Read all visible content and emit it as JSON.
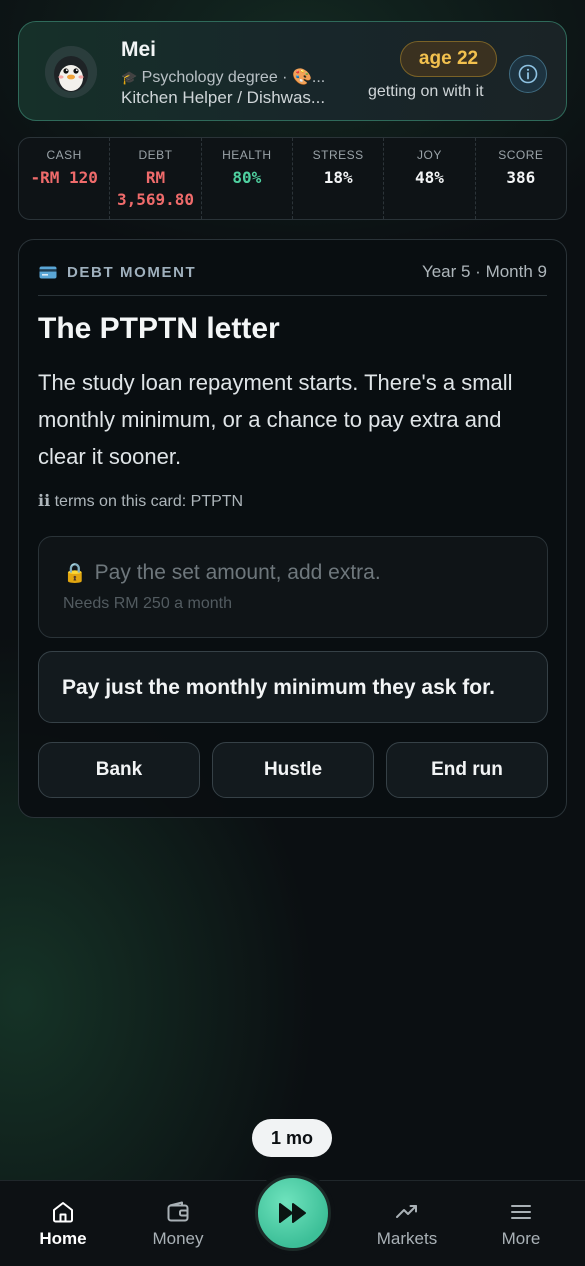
{
  "profile": {
    "name": "Mei",
    "avatar_icon": "penguin-icon",
    "degree_line": "Psychology degree · 🎨...",
    "job_line": "Kitchen Helper / Dishwas...",
    "age_label": "age 22",
    "age_status": "getting on with it"
  },
  "stats": [
    {
      "label": "CASH",
      "value": "-RM 120",
      "tone": "neg"
    },
    {
      "label": "DEBT",
      "value": "RM\n3,569.80",
      "tone": "neg"
    },
    {
      "label": "HEALTH",
      "value": "80%",
      "tone": "good"
    },
    {
      "label": "STRESS",
      "value": "18%",
      "tone": "white"
    },
    {
      "label": "JOY",
      "value": "48%",
      "tone": "white"
    },
    {
      "label": "SCORE",
      "value": "386",
      "tone": "white"
    }
  ],
  "event": {
    "tag": "DEBT MOMENT",
    "tag_icon": "credit-card-icon",
    "when": "Year 5 · Month 9",
    "title": "The PTPTN letter",
    "body": "The study loan repayment starts. There's a small monthly minimum, or a chance to pay extra and clear it sooner.",
    "terms": "ℹ︎ℹ︎ terms on this card: PTPTN",
    "choice_locked": {
      "icon": "lock-icon",
      "label": "Pay the set amount, add extra.",
      "requirement": "Needs RM 250 a month"
    },
    "choice_open": {
      "label": "Pay just the monthly minimum they ask for."
    },
    "actions": [
      "Bank",
      "Hustle",
      "End run"
    ]
  },
  "speed": "1 mo",
  "nav": {
    "items": [
      {
        "label": "Home",
        "icon": "home-icon",
        "active": true
      },
      {
        "label": "Money",
        "icon": "wallet-icon",
        "active": false
      },
      {
        "label": "Markets",
        "icon": "trend-up-icon",
        "active": false
      },
      {
        "label": "More",
        "icon": "menu-icon",
        "active": false
      }
    ],
    "play_icon": "fast-forward-icon"
  },
  "colors": {
    "accent": "#3dbf98",
    "negative": "#ef6b6b",
    "positive": "#4fd1a0",
    "age_badge": "#f2c14e"
  }
}
